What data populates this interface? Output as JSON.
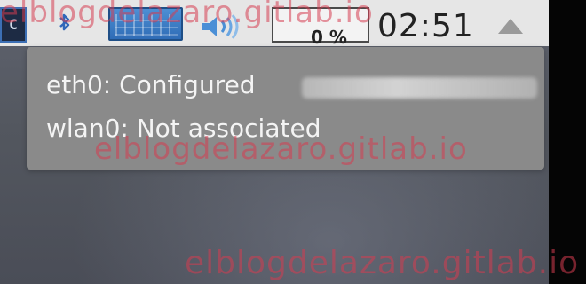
{
  "taskbar": {
    "terminal_glyph": "C",
    "clock": "02:51",
    "cpu_text": "0 %"
  },
  "network_popup": {
    "eth0_status": "eth0: Configured",
    "wlan0_status": "wlan0: Not associated"
  },
  "watermarks": [
    "elblogdelazaro.gitlab.io",
    "elblogdelazaro.gitlab.io",
    "elblogdelazaro.gitlab.io"
  ],
  "colors": {
    "taskbar_bg": "#e6e6e6",
    "popup_bg": "#8a8a8a",
    "popup_text": "#f4f4f4",
    "accent_blue": "#2f6cb6",
    "watermark": "#d63c50"
  },
  "icons": {
    "terminal": "terminal-icon",
    "bluetooth": "bluetooth-icon",
    "network": "network-icon",
    "volume": "volume-icon",
    "eject": "eject-icon"
  }
}
